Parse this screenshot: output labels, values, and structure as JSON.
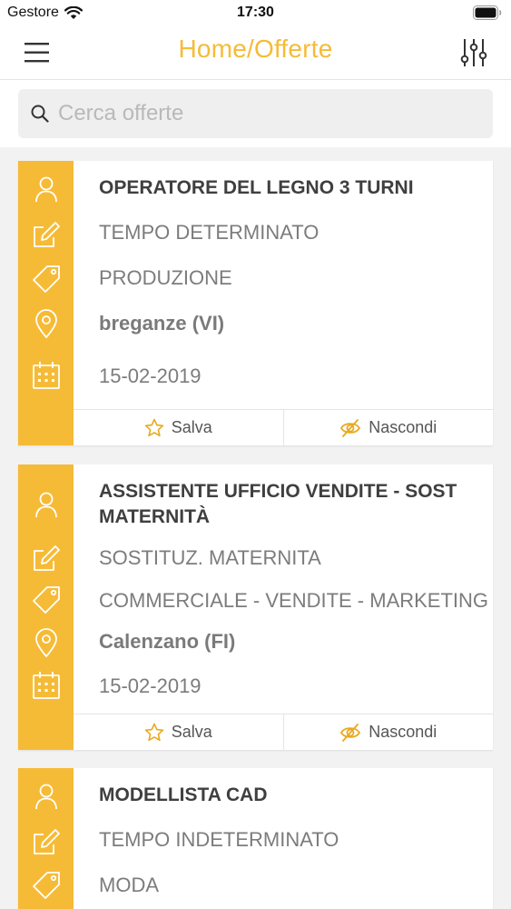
{
  "status_bar": {
    "carrier": "Gestore",
    "time": "17:30"
  },
  "nav": {
    "title": "Home/Offerte"
  },
  "search": {
    "placeholder": "Cerca offerte"
  },
  "colors": {
    "accent": "#f6bb36",
    "icon_gold": "#e9a91f"
  },
  "offers": [
    {
      "title": "OPERATORE DEL LEGNO 3 TURNI",
      "contract": "TEMPO DETERMINATO",
      "sector": "PRODUZIONE",
      "location": "breganze (VI)",
      "date": "15-02-2019",
      "save_label": "Salva",
      "hide_label": "Nascondi"
    },
    {
      "title": "ASSISTENTE UFFICIO VENDITE - SOST MATERNITÀ",
      "contract": "SOSTITUZ. MATERNITA",
      "sector": "COMMERCIALE - VENDITE - MARKETING",
      "location": "Calenzano (FI)",
      "date": "15-02-2019",
      "save_label": "Salva",
      "hide_label": "Nascondi"
    },
    {
      "title": "MODELLISTA CAD",
      "contract": "TEMPO INDETERMINATO",
      "sector": "MODA"
    }
  ]
}
